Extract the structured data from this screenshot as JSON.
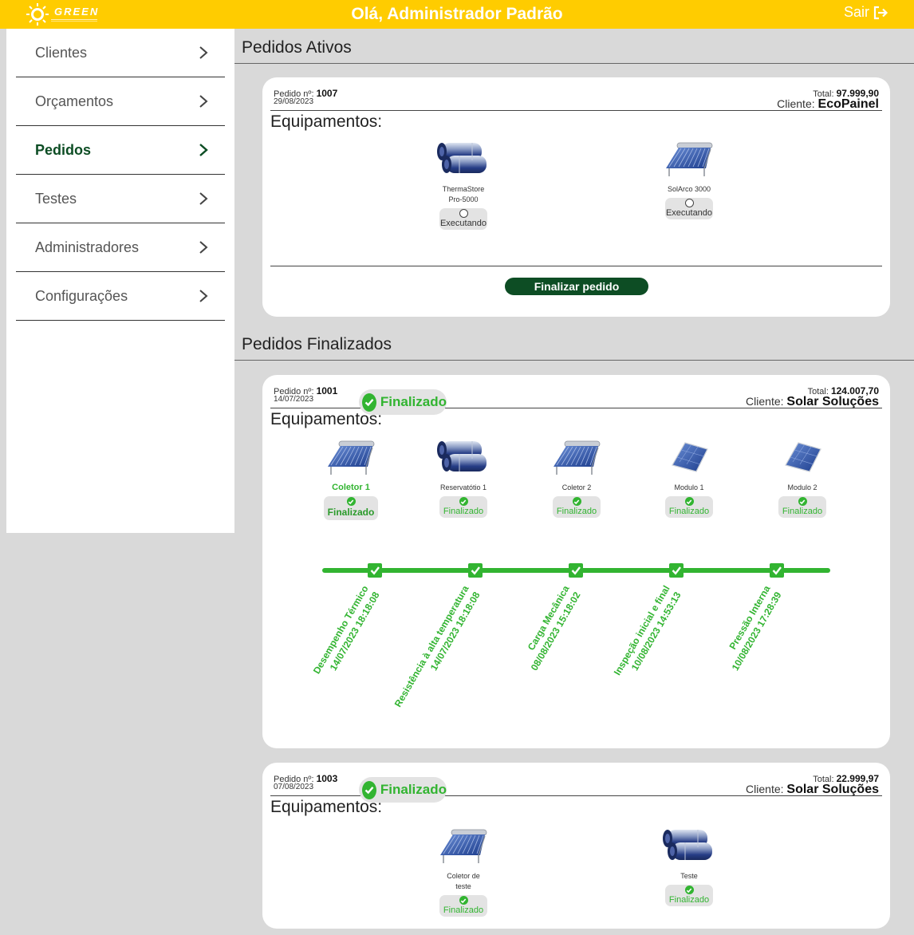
{
  "header": {
    "logo_text": "GREEN",
    "greeting": "Olá, Administrador Padrão",
    "logout_label": "Sair",
    "logout_icon": "sign-out-icon",
    "color": "#ffcc00"
  },
  "sidebar": {
    "items": [
      {
        "label": "Clientes",
        "active": false
      },
      {
        "label": "Orçamentos",
        "active": false
      },
      {
        "label": "Pedidos",
        "active": true
      },
      {
        "label": "Testes",
        "active": false
      },
      {
        "label": "Administradores",
        "active": false
      },
      {
        "label": "Configurações",
        "active": false
      }
    ],
    "chevron_icon": "chevron-right-icon",
    "active_color": "#0d4d24"
  },
  "active_section": {
    "title": "Pedidos Ativos",
    "orders": [
      {
        "order_label": "Pedido nº:",
        "order_number": "1007",
        "date": "29/08/2023",
        "total_label": "Total:",
        "total": "97.999,90",
        "client_label": "Cliente:",
        "client": "EcoPainel",
        "equipment_title": "Equipamentos:",
        "equipment": [
          {
            "name_line1": "ThermaStore",
            "name_line2": "Pro-5000",
            "status": "Executando",
            "icon": "reservoir-tank-icon"
          },
          {
            "name_line1": "SolArco 3000",
            "name_line2": "",
            "status": "Executando",
            "icon": "solar-collector-icon"
          }
        ],
        "finish_button": "Finalizar pedido"
      }
    ]
  },
  "finished_section": {
    "title": "Pedidos Finalizados",
    "orders": [
      {
        "order_label": "Pedido nº:",
        "order_number": "1001",
        "date": "14/07/2023",
        "badge": "Finalizado",
        "total_label": "Total:",
        "total": "124.007,70",
        "client_label": "Cliente:",
        "client": "Solar Soluções",
        "equipment_title": "Equipamentos:",
        "equipment": [
          {
            "name": "Coletor 1",
            "status": "Finalizado",
            "selected": true,
            "icon": "solar-collector-icon"
          },
          {
            "name": "Reservatótio 1",
            "status": "Finalizado",
            "selected": false,
            "icon": "reservoir-tank-icon"
          },
          {
            "name": "Coletor 2",
            "status": "Finalizado",
            "selected": false,
            "icon": "solar-collector-icon"
          },
          {
            "name": "Modulo 1",
            "status": "Finalizado",
            "selected": false,
            "icon": "solar-panel-icon"
          },
          {
            "name": "Modulo 2",
            "status": "Finalizado",
            "selected": false,
            "icon": "solar-panel-icon"
          }
        ],
        "timeline": [
          {
            "test": "Desempenho Térmico",
            "datetime": "14/07/2023 18:18:08"
          },
          {
            "test": "Resistência à alta temperatura",
            "datetime": "14/07/2023 18:18:08"
          },
          {
            "test": "Carga Mecânica",
            "datetime": "08/08/2023 15:18:02"
          },
          {
            "test": "Inspeção inicial e final",
            "datetime": "10/08/2023 14:53:13"
          },
          {
            "test": "Pressão Interna",
            "datetime": "10/08/2023 17:28:39"
          }
        ],
        "timeline_color": "#32b431"
      },
      {
        "order_label": "Pedido nº:",
        "order_number": "1003",
        "date": "07/08/2023",
        "badge": "Finalizado",
        "total_label": "Total:",
        "total": "22.999,97",
        "client_label": "Cliente:",
        "client": "Solar Soluções",
        "equipment_title": "Equipamentos:",
        "equipment": [
          {
            "name_line1": "Coletor de",
            "name_line2": "teste",
            "status": "Finalizado",
            "icon": "solar-collector-icon"
          },
          {
            "name_line1": "Teste",
            "name_line2": "",
            "status": "Finalizado",
            "icon": "reservoir-tank-icon"
          }
        ]
      }
    ]
  }
}
